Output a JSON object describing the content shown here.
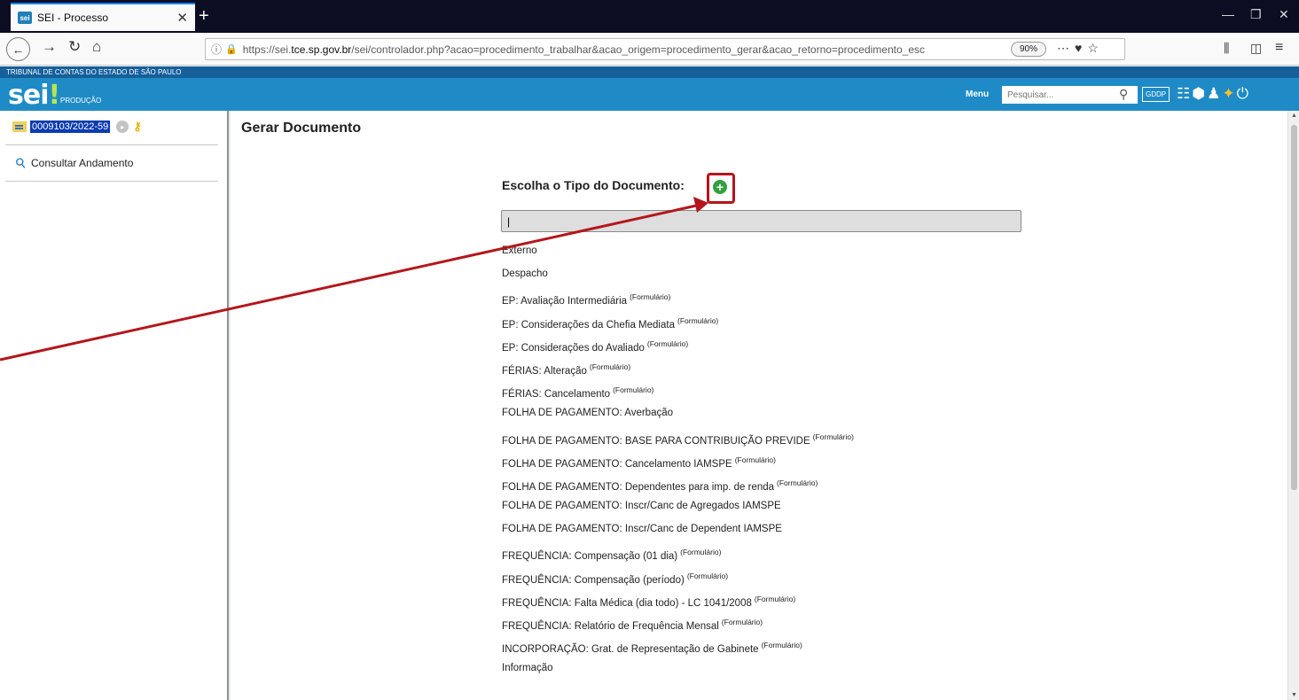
{
  "browser": {
    "tab_title": "SEI - Processo",
    "favicon_text": "sei",
    "url_prefix": "https://sei.",
    "url_domain": "tce.sp.gov.br",
    "url_rest": "/sei/controlador.php?acao=procedimento_trabalhar&acao_origem=procedimento_gerar&acao_retorno=procedimento_esc",
    "zoom": "90%"
  },
  "header": {
    "org_name": "TRIBUNAL DE CONTAS DO ESTADO DE SÃO PAULO",
    "logo": "sei",
    "logo_exclaim": "!",
    "environment": "PRODUÇÃO",
    "menu_label": "Menu",
    "search_placeholder": "Pesquisar...",
    "unit": "GDDP"
  },
  "sidebar": {
    "process_number": "0009103/2022-59",
    "consult_label": "Consultar Andamento"
  },
  "main": {
    "title": "Gerar Documento",
    "choose_label": "Escolha o Tipo do Documento:",
    "input_value": "|",
    "form_tag": "(Formulário)",
    "doc_types": [
      {
        "label": "Externo",
        "tag": ""
      },
      {
        "label": "Despacho",
        "tag": ""
      },
      {
        "label": "EP: Avaliação Intermediária",
        "tag": "(Formulário)"
      },
      {
        "label": "EP: Considerações da Chefia Mediata",
        "tag": "(Formulário)"
      },
      {
        "label": "EP: Considerações do Avaliado",
        "tag": "(Formulário)"
      },
      {
        "label": "FÉRIAS: Alteração",
        "tag": "(Formulário)"
      },
      {
        "label": "FÉRIAS: Cancelamento",
        "tag": "(Formulário)"
      },
      {
        "label": "FOLHA DE PAGAMENTO: Averbação",
        "tag": ""
      },
      {
        "label": "FOLHA DE PAGAMENTO: BASE PARA CONTRIBUIÇÃO PREVIDE",
        "tag": "(Formulário)"
      },
      {
        "label": "FOLHA DE PAGAMENTO: Cancelamento IAMSPE",
        "tag": "(Formulário)"
      },
      {
        "label": "FOLHA DE PAGAMENTO: Dependentes para imp. de renda",
        "tag": "(Formulário)"
      },
      {
        "label": "FOLHA DE PAGAMENTO: Inscr/Canc de Agregados IAMSPE",
        "tag": ""
      },
      {
        "label": "FOLHA DE PAGAMENTO: Inscr/Canc de Dependent IAMSPE",
        "tag": ""
      },
      {
        "label": "FREQUÊNCIA: Compensação (01 dia)",
        "tag": "(Formulário)"
      },
      {
        "label": "FREQUÊNCIA: Compensação (período)",
        "tag": "(Formulário)"
      },
      {
        "label": "FREQUÊNCIA: Falta Médica (dia todo) - LC 1041/2008",
        "tag": "(Formulário)"
      },
      {
        "label": "FREQUÊNCIA: Relatório de Frequência Mensal",
        "tag": "(Formulário)"
      },
      {
        "label": "INCORPORAÇÃO: Grat. de Representação de Gabinete",
        "tag": "(Formulário)"
      },
      {
        "label": "Informação",
        "tag": ""
      }
    ]
  },
  "colors": {
    "sei_blue": "#1f8bc6",
    "org_bar": "#155f9b",
    "plus_green": "#33a041",
    "annotation_red": "#b4161b"
  }
}
